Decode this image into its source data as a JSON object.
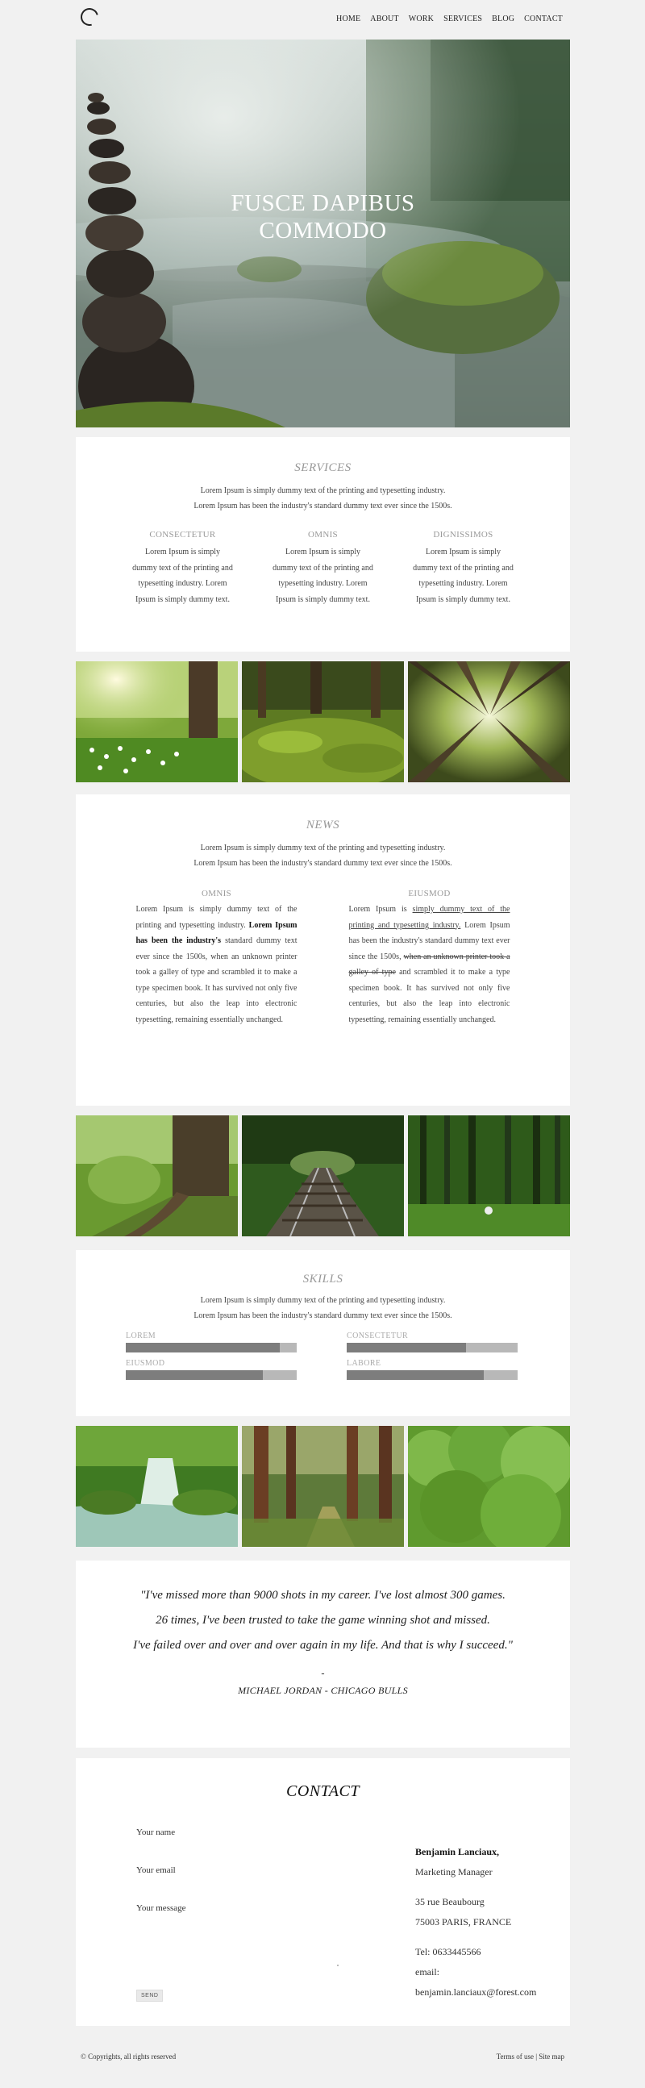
{
  "nav": {
    "items": [
      "HOME",
      "ABOUT",
      "WORK",
      "SERVICES",
      "BLOG",
      "CONTACT"
    ]
  },
  "hero": {
    "title_line1": "FUSCE DAPIBUS",
    "title_line2": "COMMODO"
  },
  "services": {
    "title": "SERVICES",
    "lead1": "Lorem Ipsum is simply dummy text of the printing and typesetting industry.",
    "lead2": "Lorem Ipsum has been the industry's standard dummy text ever since the 1500s.",
    "columns": [
      {
        "heading": "CONSECTETUR",
        "text": "Lorem Ipsum is simply dummy text of the printing and typesetting industry. Lorem Ipsum is simply dummy text."
      },
      {
        "heading": "OMNIS",
        "text": "Lorem Ipsum is simply dummy text of the printing and typesetting industry. Lorem Ipsum is simply dummy text."
      },
      {
        "heading": "DIGNISSIMOS",
        "text": "Lorem Ipsum is simply dummy text of the printing and typesetting industry. Lorem Ipsum is simply dummy text."
      }
    ]
  },
  "news": {
    "title": "NEWS",
    "lead1": "Lorem Ipsum is simply dummy text of the printing and typesetting industry.",
    "lead2": "Lorem Ipsum has been the industry's standard dummy text ever since the 1500s.",
    "col1": {
      "heading": "OMNIS",
      "p1": "Lorem Ipsum is simply dummy text of the printing and typesetting industry.",
      "p2_bold": "Lorem Ipsum has been the industry's",
      "p3": "standard dummy text ever since the 1500s, when an unknown printer took a galley of type and scrambled it to make a type specimen book. It has survived not only five centuries, but also the leap into electronic typesetting, remaining essentially unchanged."
    },
    "col2": {
      "heading": "EIUSMOD",
      "p1": "Lorem Ipsum is",
      "p2_underline": "simply dummy text of the printing and typesetting industry.",
      "p3": "Lorem Ipsum has been the industry's standard dummy text ever since the 1500s,",
      "p4_strike": "when an unknown printer took a galley of type",
      "p5": "and scrambled it to make a type specimen book. It has survived not only five centuries, but also the leap into electronic typesetting, remaining essentially unchanged."
    }
  },
  "skills": {
    "title": "SKILLS",
    "lead1": "Lorem Ipsum is simply dummy text of the printing and typesetting industry.",
    "lead2": "Lorem Ipsum has been the industry's standard dummy text ever since the 1500s.",
    "items": [
      {
        "label": "LOREM",
        "level": 0.9
      },
      {
        "label": "CONSECTETUR",
        "level": 0.7
      },
      {
        "label": "EIUSMOD",
        "level": 0.8
      },
      {
        "label": "LABORE",
        "level": 0.8
      }
    ]
  },
  "quote": {
    "line1": "\"I've missed more than 9000 shots in my career. I've lost almost 300 games.",
    "line2": "26 times, I've been trusted to take the game winning shot and missed.",
    "line3": "I've failed over and over and over again in my life. And that is why I succeed.\"",
    "dash": "-",
    "author": "MICHAEL JORDAN -",
    "team": "CHICAGO BULLS"
  },
  "contact": {
    "title": "CONTACT",
    "name_label": "Your name",
    "email_label": "Your email",
    "message_label": "Your message",
    "send_label": "SEND",
    "card": {
      "name": "Benjamin Lanciaux,",
      "role": "Marketing Manager",
      "street": "35 rue Beaubourg",
      "city": "75003 PARIS, FRANCE",
      "tel": "Tel: 0633445566",
      "email_label": "email:",
      "email": "benjamin.lanciaux@forest.com"
    }
  },
  "footer": {
    "copyright": "© Copyrights, all rights reserved",
    "terms": "Terms of use",
    "sep": "|",
    "sitemap": "Site map"
  }
}
